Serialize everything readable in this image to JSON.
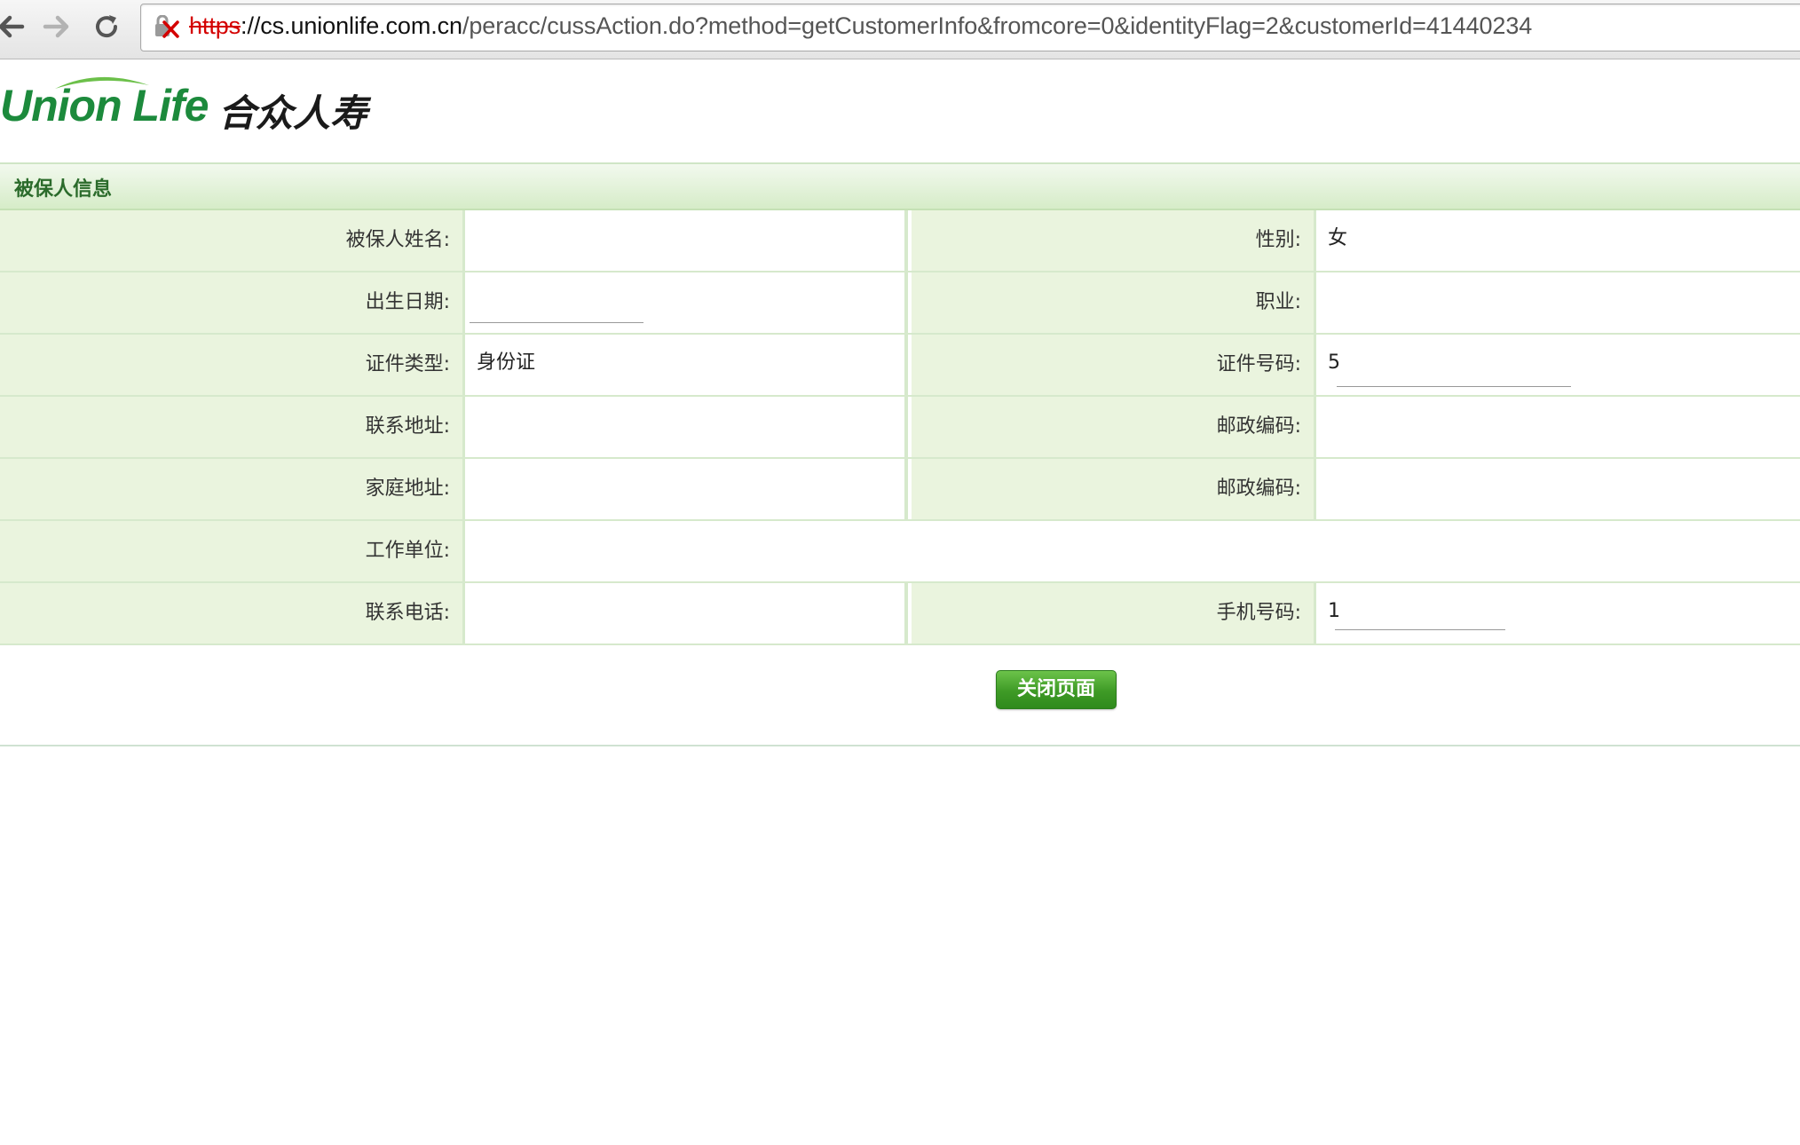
{
  "browser": {
    "url_scheme": "https",
    "url_host": "://cs.unionlife.com.cn",
    "url_path": "/peracc/cussAction.do?method=getCustomerInfo&fromcore=0&identityFlag=2&customerId=41440234",
    "colors": {
      "scheme_error": "#d40000"
    }
  },
  "header": {
    "logo_en": "Union Life",
    "logo_cn": "合众人寿",
    "colors": {
      "brand_green": "#1c8a3c"
    }
  },
  "section": {
    "title": "被保人信息"
  },
  "form": {
    "rows": [
      {
        "label1": "被保人姓名:",
        "value1": "",
        "label2": "性别:",
        "value2": "女"
      },
      {
        "label1": "出生日期:",
        "value1": "",
        "label2": "职业:",
        "value2": ""
      },
      {
        "label1": "证件类型:",
        "value1": "身份证",
        "label2": "证件号码:",
        "value2": "5"
      },
      {
        "label1": "联系地址:",
        "value1": "",
        "label2": "邮政编码:",
        "value2": ""
      },
      {
        "label1": "家庭地址:",
        "value1": "",
        "label2": "邮政编码:",
        "value2": ""
      },
      {
        "label1": "工作单位:",
        "value1": ""
      },
      {
        "label1": "联系电话:",
        "value1": "",
        "label2": "手机号码:",
        "value2": "1"
      }
    ]
  },
  "actions": {
    "close_label": "关闭页面",
    "colors": {
      "button_green": "#3e9a26"
    }
  }
}
